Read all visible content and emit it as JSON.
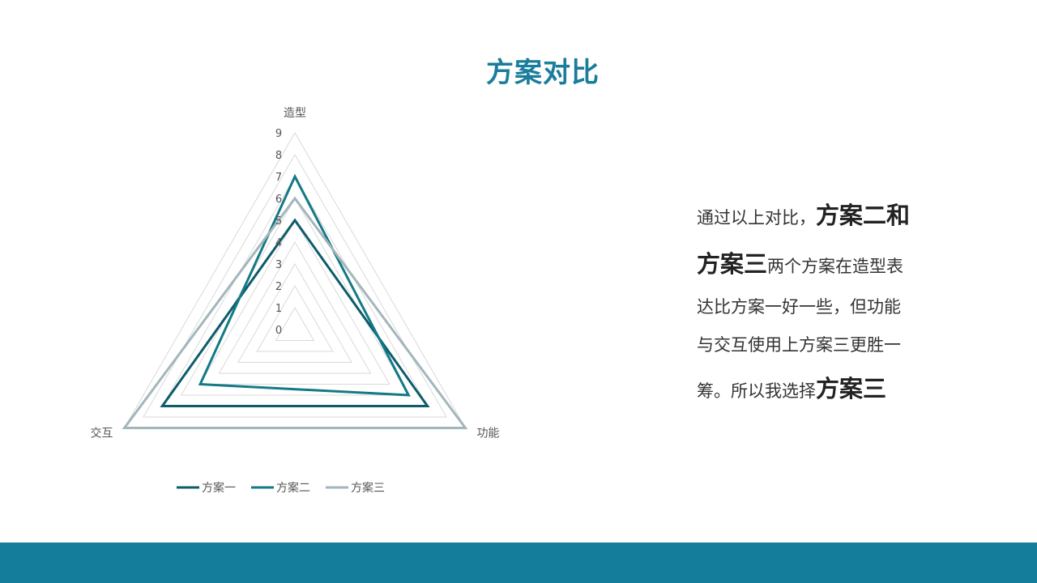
{
  "slide": {
    "title": "方案对比"
  },
  "description": {
    "line1_prefix": "通过以上对比，",
    "line1_emph": "方案二和",
    "line2_emph": "方案三",
    "line2_suffix": "两个方案在造型表",
    "line3": "达比方案一好一些，但功能",
    "line4": "与交互使用上方案三更胜一",
    "line5_prefix": "筹。所以我选择",
    "line5_emph": "方案三"
  },
  "chart_data": {
    "type": "radar",
    "axes": [
      "造型",
      "功能",
      "交互"
    ],
    "rlim": [
      0,
      9
    ],
    "ticks": [
      "0",
      "1",
      "2",
      "3",
      "4",
      "5",
      "6",
      "7",
      "8",
      "9"
    ],
    "grid": true,
    "legend_position": "bottom",
    "series": [
      {
        "name": "方案一",
        "values": [
          5,
          7,
          7
        ]
      },
      {
        "name": "方案二",
        "values": [
          7,
          6,
          5
        ]
      },
      {
        "name": "方案三",
        "values": [
          6,
          9,
          9
        ]
      }
    ]
  },
  "colors": {
    "title": "#1a7d9b",
    "footer": "#157d9c",
    "series": [
      "#0d5c6b",
      "#137a85",
      "#a3b6bc"
    ],
    "grid": "#d9d9d9"
  }
}
